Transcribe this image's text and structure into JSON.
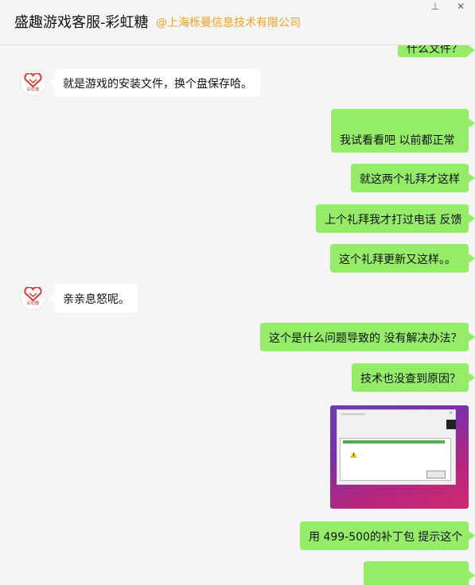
{
  "header": {
    "title": "盛趣游戏客服-彩虹糖",
    "company": "@上海栎曼信息技术有限公司",
    "pin_glyph": "⊥",
    "close_glyph": "✕"
  },
  "colors": {
    "outgoing_bubble": "#95ec69",
    "incoming_bubble": "#ffffff",
    "company_label": "#f0a020"
  },
  "avatar": {
    "label": "彩虹糖"
  },
  "messages": [
    {
      "side": "right",
      "text": "什么文件？",
      "partial": true
    },
    {
      "side": "left",
      "text": "就是游戏的安装文件，换个盘保存哈。"
    },
    {
      "side": "right",
      "text": "我试看看吧  以前都正常"
    },
    {
      "side": "right",
      "text": "就这两个礼拜才这样"
    },
    {
      "side": "right",
      "text": "上个礼拜我才打过电话 反馈"
    },
    {
      "side": "right",
      "text": "这个礼拜更新又这样。。"
    },
    {
      "side": "left",
      "text": "亲亲息怒呢。"
    },
    {
      "side": "right",
      "text": "这个是什么问题导致的 没有解决办法？"
    },
    {
      "side": "right",
      "text": "技术也没查到原因？"
    },
    {
      "side": "right",
      "type": "image",
      "alt": "error-dialog-screenshot"
    },
    {
      "side": "right",
      "text": "用 499-500的补丁包 提示这个"
    },
    {
      "side": "right",
      "text": "",
      "partial": true
    }
  ]
}
